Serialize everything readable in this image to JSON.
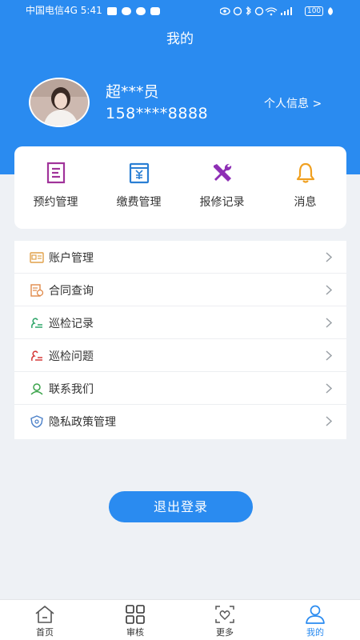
{
  "status_bar": {
    "carrier": "中国电信4G",
    "time": "5:41",
    "battery": "100"
  },
  "page_title": "我的",
  "user": {
    "name": "超***员",
    "phone": "158****8888",
    "personal_info_label": "个人信息 >"
  },
  "quick_actions": [
    {
      "label": "预约管理",
      "icon": "document-list-icon",
      "color": "#a0339a"
    },
    {
      "label": "缴费管理",
      "icon": "receipt-yen-icon",
      "color": "#2a7fd4"
    },
    {
      "label": "报修记录",
      "icon": "wrench-screwdriver-icon",
      "color": "#8e2fb5"
    },
    {
      "label": "消息",
      "icon": "bell-icon",
      "color": "#f0a020"
    }
  ],
  "menu_items": [
    {
      "label": "账户管理",
      "icon": "id-card-icon"
    },
    {
      "label": "合同查询",
      "icon": "contract-icon"
    },
    {
      "label": "巡检记录",
      "icon": "inspection-record-icon"
    },
    {
      "label": "巡检问题",
      "icon": "inspection-issue-icon"
    },
    {
      "label": "联系我们",
      "icon": "contact-person-icon"
    },
    {
      "label": "隐私政策管理",
      "icon": "privacy-shield-icon"
    }
  ],
  "logout_label": "退出登录",
  "tabs": [
    {
      "label": "首页",
      "icon": "home-icon",
      "active": false
    },
    {
      "label": "审核",
      "icon": "grid-icon",
      "active": false
    },
    {
      "label": "更多",
      "icon": "scan-heart-icon",
      "active": false
    },
    {
      "label": "我的",
      "icon": "profile-icon",
      "active": true
    }
  ],
  "colors": {
    "primary": "#2a8bf0",
    "background": "#eef1f5"
  }
}
